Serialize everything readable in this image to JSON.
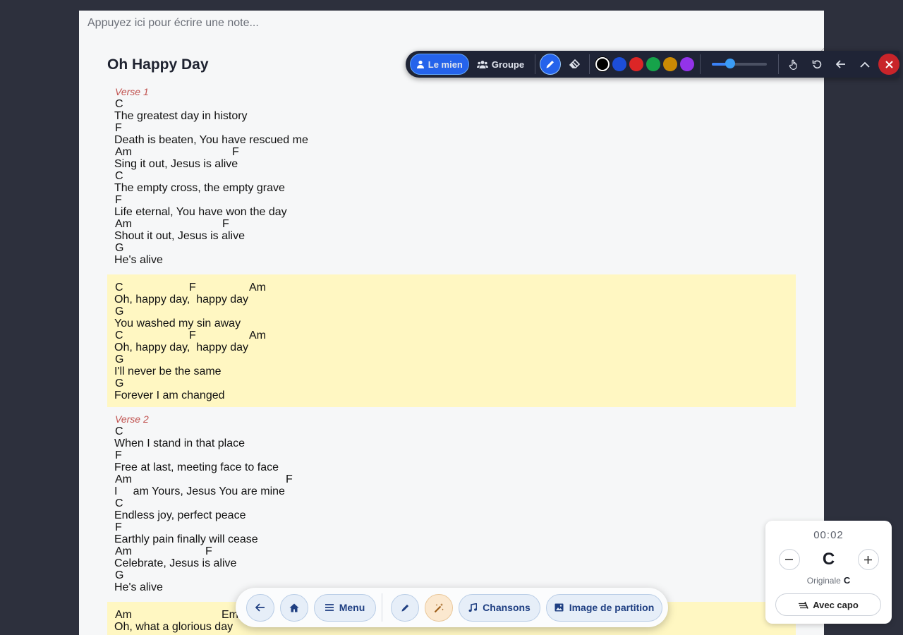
{
  "note": {
    "placeholder": "Appuyez ici pour écrire une note..."
  },
  "song": {
    "title": "Oh Happy Day",
    "sections": [
      {
        "label": "Verse 1",
        "chorus": false,
        "lines": [
          {
            "chords": [
              [
                "C",
                0
              ]
            ],
            "lyric": "The greatest day in history"
          },
          {
            "chords": [
              [
                "F",
                0
              ]
            ],
            "lyric": "Death is beaten, You have rescued me"
          },
          {
            "chords": [
              [
                "Am",
                0
              ],
              [
                "F",
                166
              ]
            ],
            "lyric": "Sing it out, Jesus is alive"
          },
          {
            "chords": [
              [
                "C",
                0
              ]
            ],
            "lyric": "The empty cross, the empty grave"
          },
          {
            "chords": [
              [
                "F",
                0
              ]
            ],
            "lyric": "Life eternal, You have won the day"
          },
          {
            "chords": [
              [
                "Am",
                0
              ],
              [
                "F",
                152
              ]
            ],
            "lyric": "Shout it out, Jesus is alive"
          },
          {
            "chords": [
              [
                "G",
                0
              ]
            ],
            "lyric": "He's alive"
          }
        ]
      },
      {
        "label": "",
        "chorus": true,
        "lines": [
          {
            "chords": [
              [
                "C",
                0
              ],
              [
                "F",
                105
              ],
              [
                "Am",
                190
              ]
            ],
            "lyric": "Oh, happy day,  happy day"
          },
          {
            "chords": [
              [
                "G",
                0
              ]
            ],
            "lyric": "You washed my sin away"
          },
          {
            "chords": [
              [
                "C",
                0
              ],
              [
                "F",
                105
              ],
              [
                "Am",
                190
              ]
            ],
            "lyric": "Oh, happy day,  happy day"
          },
          {
            "chords": [
              [
                "G",
                0
              ]
            ],
            "lyric": "I'll never be the same"
          },
          {
            "chords": [
              [
                "G",
                0
              ]
            ],
            "lyric": "Forever I am changed"
          }
        ]
      },
      {
        "label": "Verse 2",
        "chorus": false,
        "lines": [
          {
            "chords": [
              [
                "C",
                0
              ]
            ],
            "lyric": "When I stand in that place"
          },
          {
            "chords": [
              [
                "F",
                0
              ]
            ],
            "lyric": "Free at last, meeting face to face"
          },
          {
            "chords": [
              [
                "Am",
                0
              ],
              [
                "F",
                242
              ]
            ],
            "lyric": "I     am Yours, Jesus You are mine"
          },
          {
            "chords": [
              [
                "C",
                0
              ]
            ],
            "lyric": "Endless joy, perfect peace"
          },
          {
            "chords": [
              [
                "F",
                0
              ]
            ],
            "lyric": "Earthly pain finally will cease"
          },
          {
            "chords": [
              [
                "Am",
                0
              ],
              [
                "F",
                128
              ]
            ],
            "lyric": "Celebrate, Jesus is alive"
          },
          {
            "chords": [
              [
                "G",
                0
              ]
            ],
            "lyric": "He's alive"
          }
        ]
      },
      {
        "label": "",
        "chorus": true,
        "lines": [
          {
            "chords": [
              [
                "Am",
                0
              ],
              [
                "Em",
                151
              ]
            ],
            "lyric": "Oh, what a glorious day"
          }
        ]
      }
    ]
  },
  "toolbar": {
    "mine_label": "Le mien",
    "group_label": "Groupe",
    "colors": [
      "#000000",
      "#1d4ed8",
      "#dc2626",
      "#16a34a",
      "#ca8a04",
      "#9333ea"
    ],
    "stroke_level": 0.33
  },
  "bottom_nav": {
    "menu_label": "Menu",
    "songs_label": "Chansons",
    "sheet_image_label": "Image de partition"
  },
  "transpose": {
    "timer": "00:02",
    "key": "C",
    "original_label": "Originale",
    "original_key": "C",
    "capo_label": "Avec capo"
  },
  "icons": [
    "user-icon",
    "users-icon",
    "pencil-icon",
    "eraser-icon",
    "hand-icon",
    "undo-icon",
    "arrow-left-icon",
    "chevron-up-icon",
    "close-icon",
    "home-icon",
    "menu-icon",
    "magic-wand-icon",
    "music-note-icon",
    "image-icon",
    "capo-icon"
  ]
}
